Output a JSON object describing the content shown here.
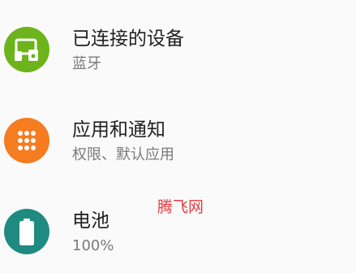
{
  "settings": {
    "items": [
      {
        "title": "已连接的设备",
        "subtitle": "蓝牙",
        "icon": "connected-devices-icon",
        "color": "#6db31b"
      },
      {
        "title": "应用和通知",
        "subtitle": "权限、默认应用",
        "icon": "apps-grid-icon",
        "color": "#f57c1f"
      },
      {
        "title": "电池",
        "subtitle": "100%",
        "icon": "battery-icon",
        "color": "#1f8a7f"
      }
    ]
  },
  "watermark": {
    "text": "腾飞网",
    "color": "#e8393f"
  }
}
